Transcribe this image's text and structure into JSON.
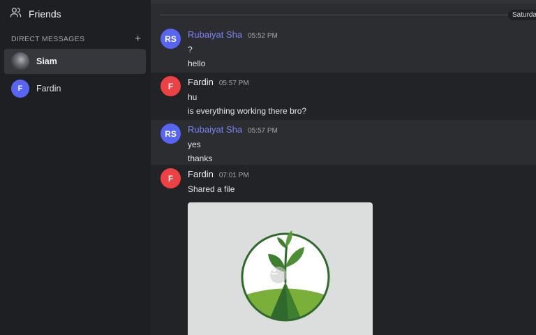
{
  "sidebar": {
    "friends_label": "Friends",
    "dm_header": "DIRECT MESSAGES",
    "dm_add": "+",
    "dms": [
      {
        "name": "Siam",
        "avatar": "photo"
      },
      {
        "name": "Fardin",
        "avatar_letter": "F"
      }
    ]
  },
  "chat": {
    "date_label": "Saturda",
    "groups": [
      {
        "initials": "RS",
        "author": "Rubaiyat Sha",
        "time": "05:52 PM",
        "lines": [
          "?",
          "hello"
        ],
        "color": "#5865f2"
      },
      {
        "initials": "F",
        "author": "Fardin",
        "time": "05:57 PM",
        "lines": [
          "hu",
          "is everything working there bro?"
        ],
        "color": "#ed4245"
      },
      {
        "initials": "RS",
        "author": "Rubaiyat Sha",
        "time": "05:57 PM",
        "lines": [
          "yes",
          "thanks"
        ],
        "color": "#5865f2"
      },
      {
        "initials": "F",
        "author": "Fardin",
        "time": "07:01 PM",
        "lines": [
          "Shared a file"
        ],
        "color": "#ed4245"
      }
    ]
  },
  "colors": {
    "accent": "#5865f2",
    "danger": "#ed4245",
    "sidebar_bg": "#1e1f22",
    "chat_bg": "#2b2d31"
  },
  "icons": [
    "friends-icon",
    "plus-icon",
    "download-icon",
    "plant-logo-icon"
  ]
}
